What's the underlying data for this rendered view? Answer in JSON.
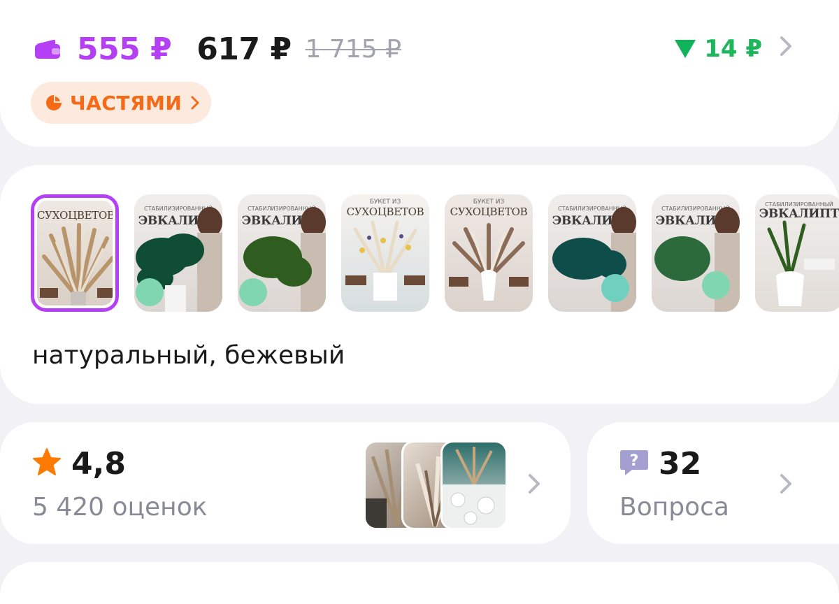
{
  "price": {
    "card_price": "555 ₽",
    "regular_price": "617 ₽",
    "old_price": "1 715 ₽",
    "price_drop": "14 ₽",
    "parts_label": "ЧАСТЯМИ",
    "accent_color": "#b43ff5",
    "drop_color": "#11b35a",
    "parts_color": "#f46a16"
  },
  "variants": {
    "thumbnails": [
      {
        "title": "СУХОЦВЕТОВ",
        "selected": true
      },
      {
        "title": "ЭВКАЛИПТ",
        "subtitle": "СТАБИЛИЗИРОВАННЫЙ",
        "selected": false
      },
      {
        "title": "ЭВКАЛИПТ",
        "subtitle": "СТАБИЛИЗИРОВАННЫЙ",
        "selected": false
      },
      {
        "title": "СУХОЦВЕТОВ",
        "subtitle": "БУКЕТ ИЗ",
        "selected": false
      },
      {
        "title": "СУХОЦВЕТОВ",
        "subtitle": "БУКЕТ ИЗ",
        "selected": false
      },
      {
        "title": "ЭВКАЛИПТ",
        "subtitle": "СТАБИЛИЗИРОВАННЫЙ",
        "selected": false
      },
      {
        "title": "ЭВКАЛИПТ",
        "subtitle": "СТАБИЛИЗИРОВАННЫЙ",
        "selected": false
      },
      {
        "title": "ЭВКАЛИПТ",
        "subtitle": "СТАБИЛИЗИРОВАННЫЙ",
        "selected": false
      }
    ],
    "selected_name": "натуральный, бежевый"
  },
  "rating": {
    "value": "4,8",
    "count": "5 420 оценок",
    "star_color": "#ff7a00"
  },
  "questions": {
    "value": "32",
    "label": "Вопроса"
  }
}
